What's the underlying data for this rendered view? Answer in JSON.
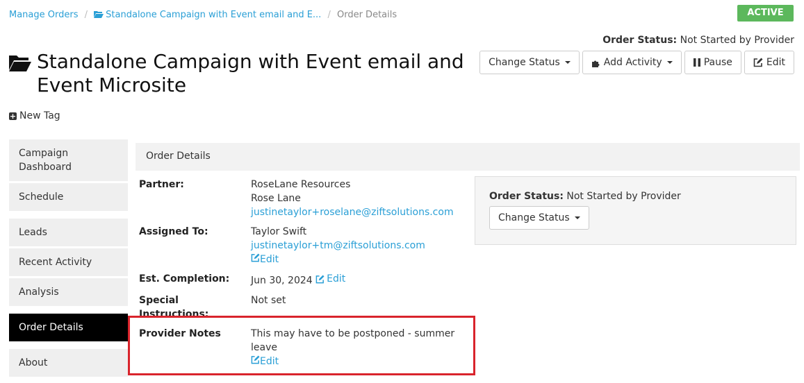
{
  "breadcrumb": {
    "item1": "Manage Orders",
    "item2": "Standalone Campaign with Event email and E...",
    "item3": "Order Details",
    "separator": "/"
  },
  "badge": "ACTIVE",
  "order_status": {
    "label": "Order Status:",
    "value": "Not Started by Provider"
  },
  "title": "Standalone Campaign with Event email and Event Microsite",
  "toolbar": {
    "change_status": "Change Status",
    "add_activity": "Add Activity",
    "pause": "Pause",
    "edit": "Edit"
  },
  "new_tag": "New Tag",
  "sidebar": {
    "items": [
      "Campaign Dashboard",
      "Schedule",
      "Leads",
      "Recent Activity",
      "Analysis",
      "Order Details",
      "About"
    ]
  },
  "panel_title": "Order Details",
  "details": {
    "partner_label": "Partner:",
    "partner_company": "RoseLane Resources",
    "partner_name": "Rose Lane",
    "partner_email": "justinetaylor+roselane@ziftsolutions.com",
    "assigned_label": "Assigned To:",
    "assigned_name": "Taylor Swift",
    "assigned_email": "justinetaylor+tm@ziftsolutions.com",
    "edit_label": "Edit",
    "est_label": "Est. Completion:",
    "est_value": "Jun 30, 2024",
    "special_label": "Special Instructions:",
    "special_value": "Not set",
    "notes_label": "Provider Notes",
    "notes_value": "This may have to be postponed - summer leave"
  },
  "status_panel": {
    "label": "Order Status:",
    "value": "Not Started by Provider",
    "button": "Change Status"
  },
  "colors": {
    "accent": "#2a9fd6",
    "active": "#5cb85c",
    "highlight": "#d9242c"
  },
  "icons": {
    "folder": "folder-open-icon",
    "puzzle": "puzzle-icon",
    "pause": "pause-icon",
    "edit": "edit-icon",
    "plus": "plus-square-icon"
  }
}
